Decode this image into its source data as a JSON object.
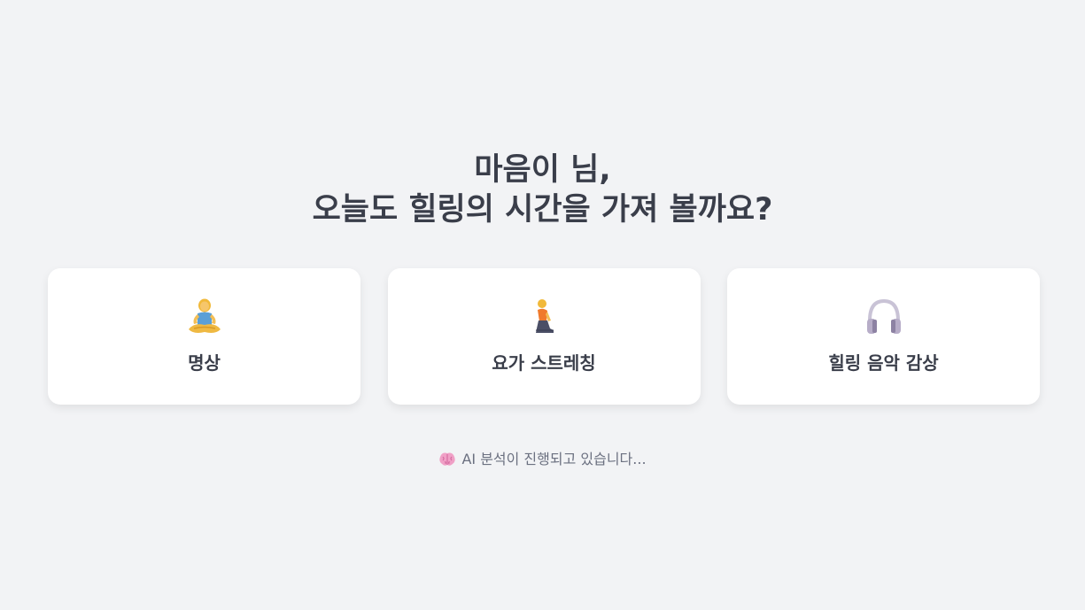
{
  "greeting": {
    "line1": "마음이 님,",
    "line2": "오늘도 힐링의 시간을 가져 볼까요?"
  },
  "activities": [
    {
      "label": "명상",
      "icon": "meditation-icon"
    },
    {
      "label": "요가 스트레칭",
      "icon": "yoga-kneeling-icon"
    },
    {
      "label": "힐링 음악 감상",
      "icon": "headphones-icon"
    }
  ],
  "status": {
    "icon": "brain-icon",
    "text": "AI 분석이 진행되고 있습니다..."
  },
  "colors": {
    "background": "#f2f3f5",
    "card": "#ffffff",
    "heading": "#3a3e4a",
    "status_text": "#6b7080"
  }
}
